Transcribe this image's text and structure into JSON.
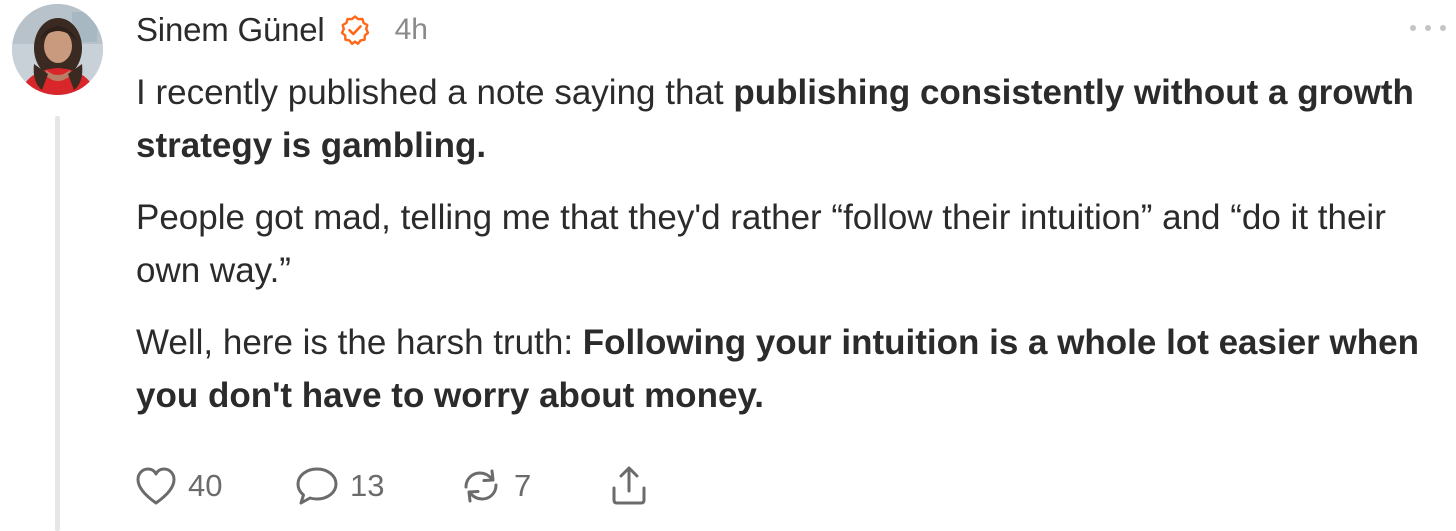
{
  "note": {
    "author": "Sinem Günel",
    "timestamp": "4h",
    "verified_color": "#ff6719",
    "paragraphs": [
      {
        "parts": [
          {
            "text": "I recently published a note saying that ",
            "bold": false
          },
          {
            "text": "publishing consistently without a growth strategy is gambling.",
            "bold": true
          }
        ]
      },
      {
        "parts": [
          {
            "text": "People got mad, telling me that they'd rather “follow their intuition” and “do it their own way.”",
            "bold": false
          }
        ]
      },
      {
        "parts": [
          {
            "text": "Well, here is the harsh truth: ",
            "bold": false
          },
          {
            "text": "Following your intuition is a whole lot easier when you don't have to worry about money.",
            "bold": true
          }
        ]
      }
    ]
  },
  "actions": {
    "like_count": "40",
    "comment_count": "13",
    "restack_count": "7"
  },
  "icons": {
    "like": "heart-icon",
    "comment": "speech-bubble-icon",
    "restack": "restack-arrows-icon",
    "share": "share-upload-icon",
    "more": "more-dots-icon",
    "verified": "verified-check-badge-icon"
  }
}
